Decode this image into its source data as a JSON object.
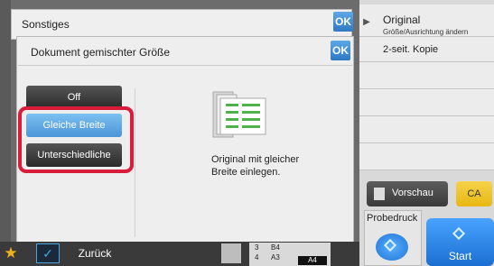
{
  "header": {
    "title": "Sonstiges",
    "ok_label": "OK"
  },
  "dialog": {
    "title": "Dokument gemischter Größe",
    "ok_label": "OK",
    "options": [
      {
        "label": "Off",
        "selected": false
      },
      {
        "label": "Gleiche Breite",
        "selected": true
      },
      {
        "label": "Unterschiedliche",
        "selected": false
      }
    ],
    "hint": "Original mit gleicher\nBreite einlegen."
  },
  "right_panel": {
    "original_title": "Original",
    "original_subtitle": "Größe/Ausrichtung ändern",
    "duplex": "2-seit. Kopie",
    "preview_label": "Vorschau",
    "ca_label": "CA",
    "proof_label": "Probedruck",
    "start_label": "Start"
  },
  "bottom": {
    "back_label": "Zurück",
    "tray": [
      {
        "num": "3",
        "size": "B4"
      },
      {
        "num": "4",
        "size": "A3"
      }
    ],
    "tray_selected": "A4"
  },
  "colors": {
    "accent_blue": "#4b95d8",
    "highlight_red": "#d81c3a",
    "ca_yellow": "#e7b712"
  }
}
